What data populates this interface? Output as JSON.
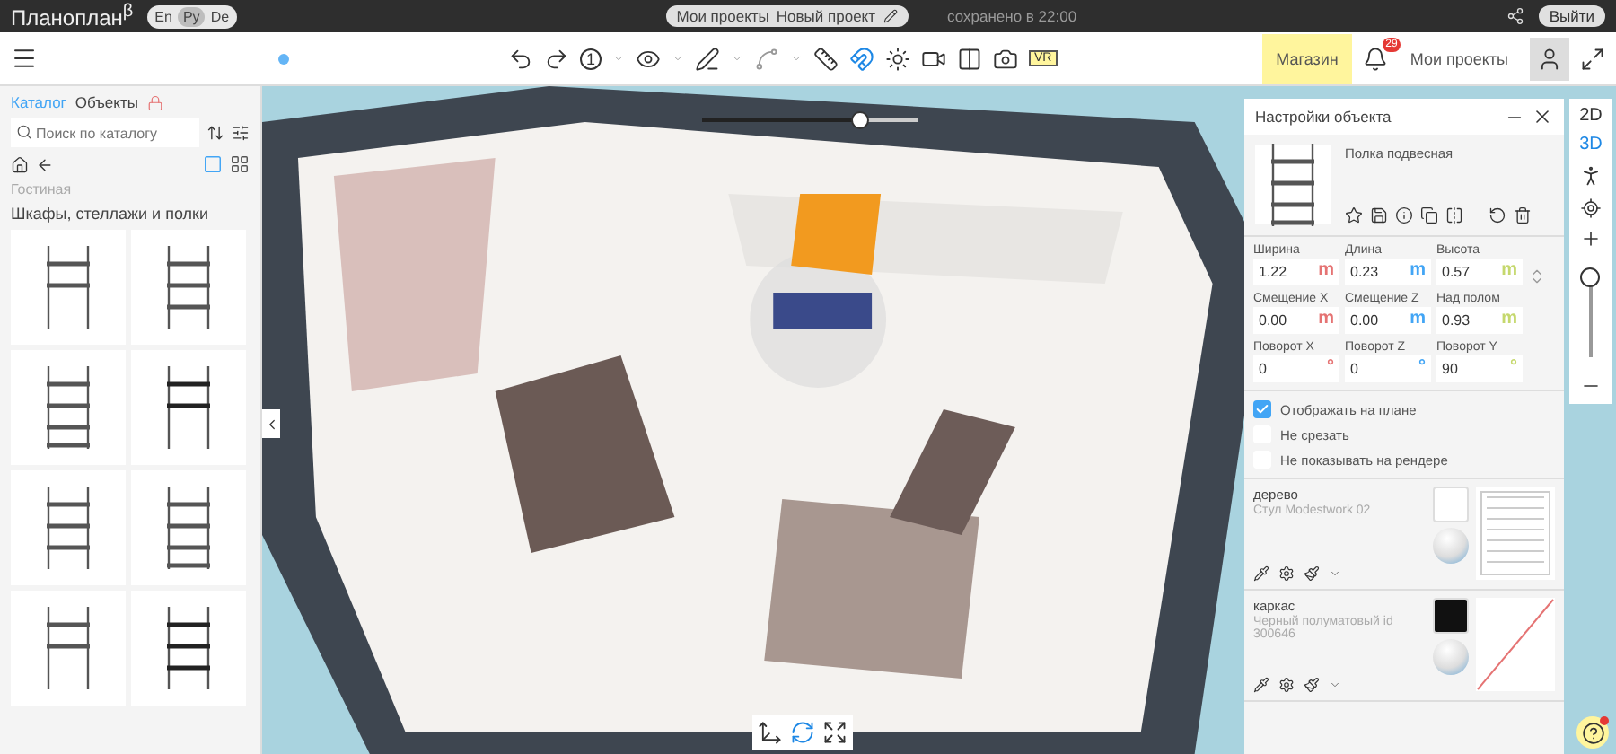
{
  "topbar": {
    "logo": "Планоплан$^{β}$",
    "languages": [
      {
        "label": "En",
        "selected": false
      },
      {
        "label": "Ру",
        "selected": true
      },
      {
        "label": "De",
        "selected": false
      }
    ],
    "breadcrumb": [
      "Мои проекты",
      "Новый проект"
    ],
    "saved": "сохранено в 22:00",
    "logout": "Выйти"
  },
  "toolbar": {
    "floor": "1",
    "vr": "VR",
    "snap_on": true,
    "shop": "Магазин",
    "notifications": "29",
    "my_projects": "Мои проекты"
  },
  "sidebar": {
    "tabs": [
      {
        "label": "Каталог",
        "selected": true
      },
      {
        "label": "Объекты",
        "selected": false
      }
    ],
    "search": {
      "placeholder": "Поиск по каталогу"
    },
    "views": [
      {
        "kind": "large",
        "selected": true
      },
      {
        "kind": "small",
        "selected": false
      }
    ],
    "path": "Гостиная",
    "heading": "Шкафы, стеллажи и полки"
  },
  "viewport": {
    "zoom": {
      "level": 0.73
    }
  },
  "object_panel": {
    "title": "Настройки объекта",
    "name": "Полка подвесная",
    "fields": [
      {
        "label": "Ширина",
        "value": "1.22",
        "unit": "m",
        "color": "#e57373"
      },
      {
        "label": "Длина",
        "value": "0.23",
        "unit": "m",
        "color": "#42a5f5"
      },
      {
        "label": "Высота",
        "value": "0.57",
        "unit": "m",
        "color": "#c5d86d"
      },
      {
        "label": "Смещение X",
        "value": "0.00",
        "unit": "m",
        "color": "#e57373"
      },
      {
        "label": "Смещение Z",
        "value": "0.00",
        "unit": "m",
        "color": "#42a5f5"
      },
      {
        "label": "Над полом",
        "value": "0.93",
        "unit": "m",
        "color": "#c5d86d"
      },
      {
        "label": "Поворот X",
        "value": "0",
        "unit": "°",
        "color": "#e57373"
      },
      {
        "label": "Поворот Z",
        "value": "0",
        "unit": "°",
        "color": "#42a5f5"
      },
      {
        "label": "Поворот Y",
        "value": "90",
        "unit": "°",
        "color": "#c5d86d"
      }
    ],
    "checkboxes": [
      {
        "label": "Отображать на плане",
        "checked": true
      },
      {
        "label": "Не срезать",
        "checked": false
      },
      {
        "label": "Не показывать на рендере",
        "checked": false
      }
    ],
    "materials": [
      {
        "name": "дерево",
        "description": "Стул Modestwork 02",
        "color": "#ffffff",
        "kind": "texture"
      },
      {
        "name": "каркас",
        "description": "Черный полуматовый id 300646",
        "color": "#111111",
        "kind": "none"
      }
    ]
  },
  "view_bar": {
    "modes": [
      {
        "label": "2D",
        "selected": false
      },
      {
        "label": "3D",
        "selected": true
      }
    ],
    "zoom": {
      "level": 0.88
    }
  }
}
